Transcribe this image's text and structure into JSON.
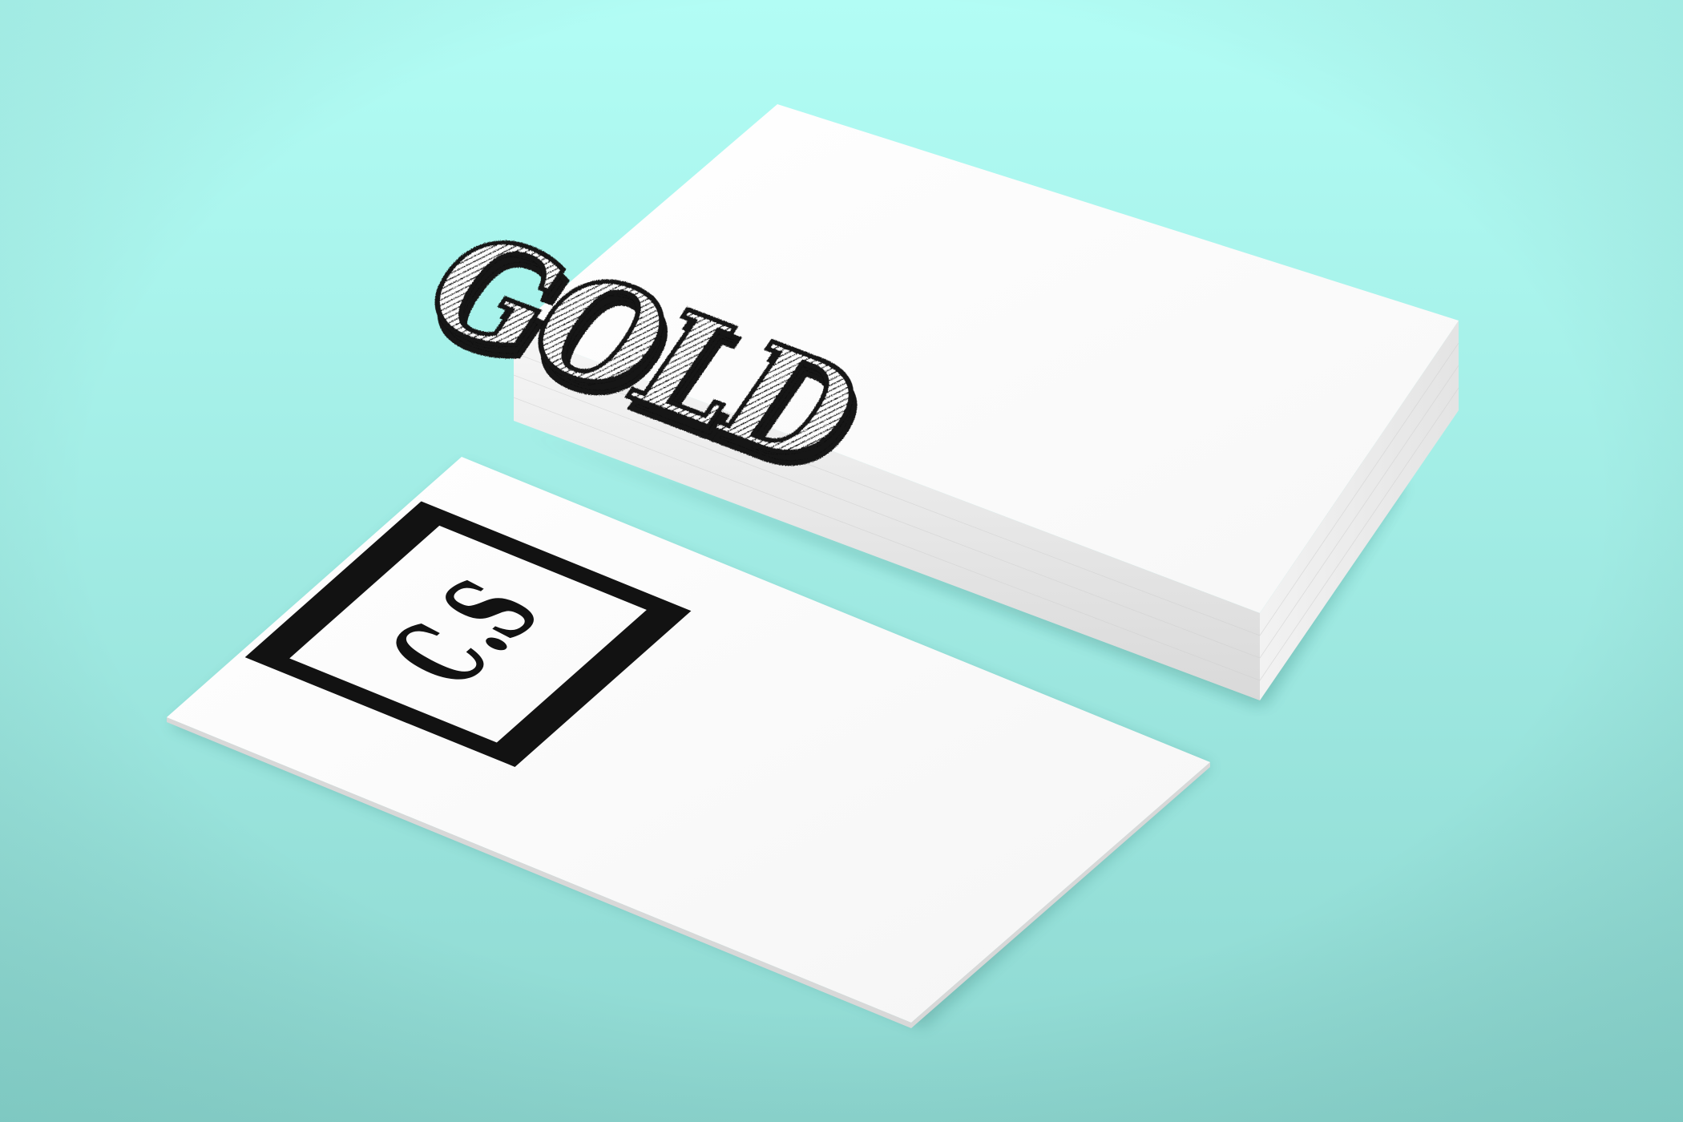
{
  "scene": {
    "background": {
      "top": "#b2fdf5",
      "bottom": "#8ed8d1"
    },
    "card_color": "#ffffff",
    "edge_color": "#e6e6e6",
    "ink_color": "#121212"
  },
  "card_stack": {
    "logo_text": "GOLD"
  },
  "single_card": {
    "monogram_text": "C.S"
  }
}
